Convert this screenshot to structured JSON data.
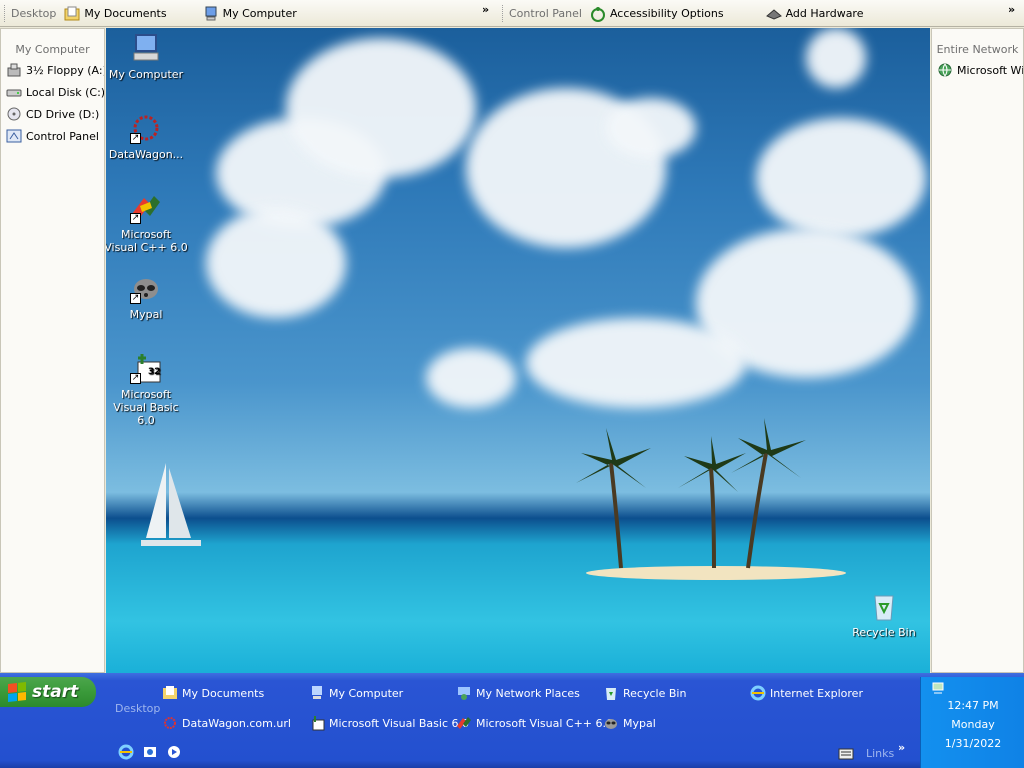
{
  "toolbar_desktop": {
    "caption": "Desktop",
    "items": [
      "My Documents",
      "My Computer"
    ]
  },
  "toolbar_control": {
    "caption": "Control Panel",
    "items": [
      "Accessibility Options",
      "Add Hardware"
    ]
  },
  "chevron": "»",
  "left_pane": {
    "caption": "My Computer",
    "items": [
      "3½ Floppy (A:)",
      "Local Disk (C:)",
      "CD Drive (D:)",
      "Control Panel"
    ]
  },
  "right_pane": {
    "caption": "Entire Network",
    "items": [
      "Microsoft Win"
    ]
  },
  "desktop_icons": {
    "my_computer": "My Computer",
    "datawagon": "DataWagon...",
    "vcpp": "Microsoft Visual C++ 6.0",
    "mypal": "Mypal",
    "vb": "Microsoft Visual Basic 6.0",
    "recycle": "Recycle Bin"
  },
  "taskbar": {
    "start_label": "start",
    "desktop_caption": "Desktop",
    "row1": [
      "My Documents",
      "My Computer",
      "My Network Places",
      "Recycle Bin",
      "Internet Explorer"
    ],
    "row2": [
      "DataWagon.com.url",
      "Microsoft Visual Basic 6.0",
      "Microsoft Visual C++ 6.0",
      "Mypal"
    ],
    "links_label": "Links",
    "links_chevron": "»"
  },
  "clock": {
    "time": "12:47 PM",
    "day": "Monday",
    "date": "1/31/2022"
  },
  "colors": {
    "taskbar": "#2350cf",
    "start": "#3a9a3a",
    "tray": "#0f82e6",
    "pane": "#fbfaf6"
  }
}
